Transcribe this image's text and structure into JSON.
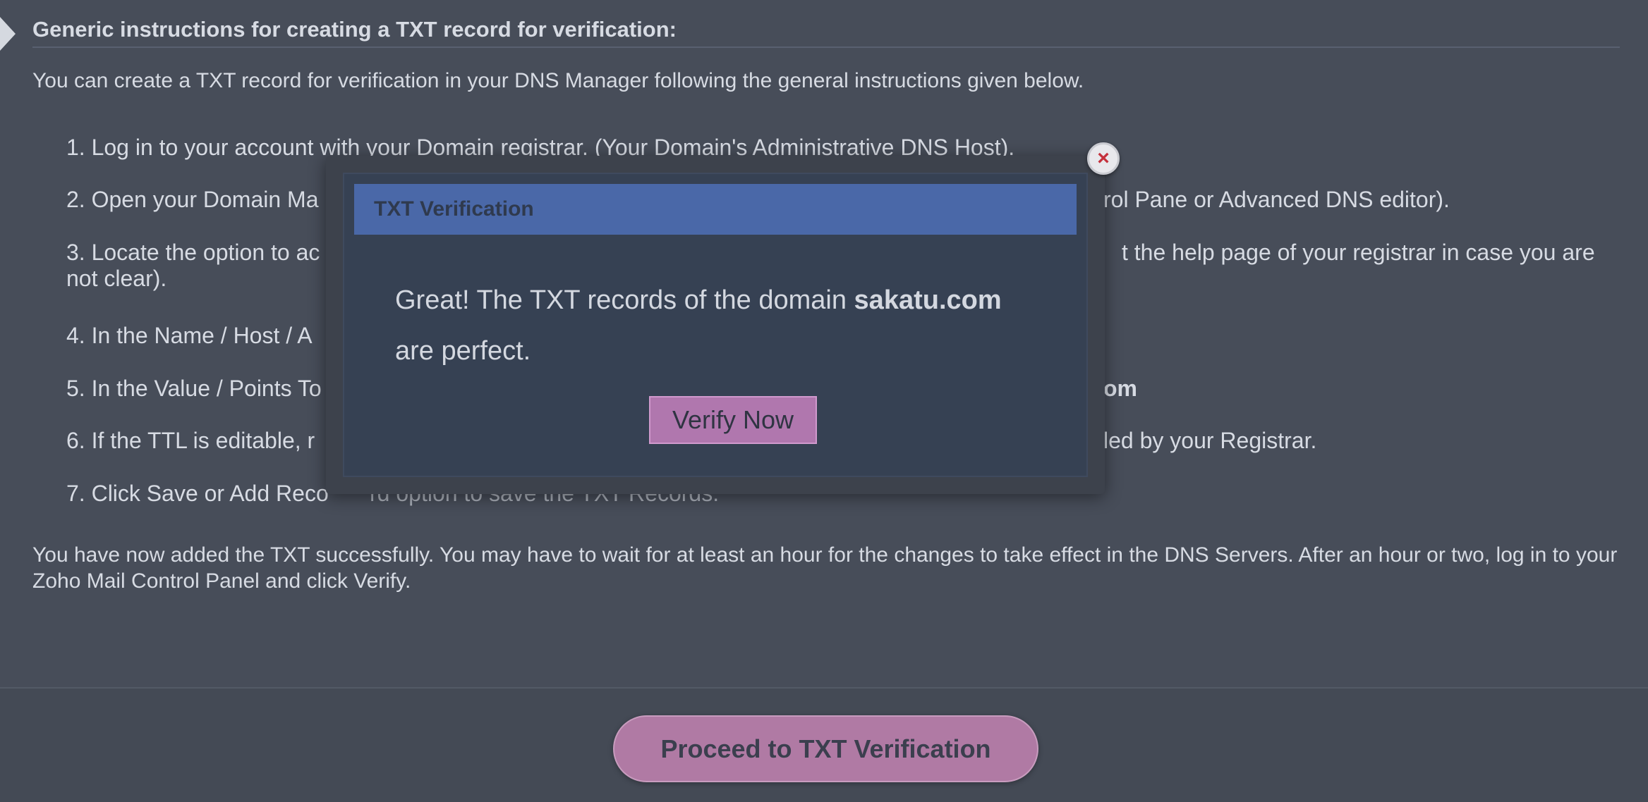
{
  "section": {
    "title": "Generic instructions for creating a TXT record for verification:",
    "intro": "You can create a TXT record for verification in your DNS Manager following the general instructions given below."
  },
  "steps": {
    "s1": "1. Log in to your account with your Domain registrar. (Your Domain's Administrative DNS Host).",
    "s2a": "2. Open your Domain Ma",
    "s2b": "rol Pane or Advanced DNS editor).",
    "s3a": "3. Locate the option to ac",
    "s3b": "t the help page of your registrar in case you are",
    "s3c": "not clear).",
    "s4": "4. In the Name / Host / A",
    "s5a": "5. In the Value / Points To",
    "s5b": "om",
    "s6a": "6. If the TTL is editable, r",
    "s6b": "led by your Registrar.",
    "s7a": "7. Click Save or Add Reco",
    "s7b": "rd option to save the TXT Records."
  },
  "outro": "You have now added the TXT successfully. You may have to wait for at least an hour for the changes to take effect in the DNS Servers. After an hour or two, log in to your Zoho Mail Control Panel and click Verify.",
  "footer": {
    "proceed_label": "Proceed to TXT Verification"
  },
  "modal": {
    "title": "TXT Verification",
    "message_prefix": "Great! The TXT records of the domain ",
    "domain": "sakatu.com",
    "message_suffix": "are perfect.",
    "verify_label": "Verify Now",
    "close_glyph": "×"
  },
  "colors": {
    "background": "#474d59",
    "modal_header": "#4a68a8",
    "button_accent": "#b07aa4",
    "close_x": "#c4303c"
  }
}
